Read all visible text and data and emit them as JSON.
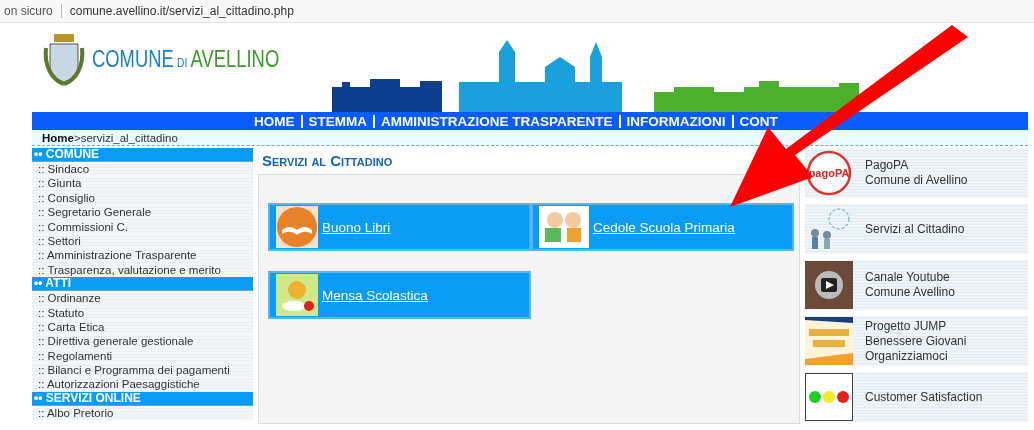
{
  "address_bar": {
    "security": "on sicuro",
    "url": "comune.avellino.it/servizi_al_cittadino.php"
  },
  "header": {
    "name_first": "COMUNE",
    "name_middle": "DI",
    "name_last": "AVELLINO"
  },
  "nav": [
    "HOME",
    "STEMMA",
    "AMMINISTRAZIONE TRASPARENTE",
    "INFORMAZIONI",
    "CONT"
  ],
  "breadcrumb": {
    "home": "Home",
    "current": ">servizi_al_cittadino"
  },
  "sidebar": [
    {
      "title": "•• COMUNE",
      "items": [
        ":: Sindaco",
        ":: Giunta",
        ":: Consiglio",
        ":: Segretario Generale",
        ":: Commissioni C.",
        ":: Settori",
        ":: Amministrazione Trasparente",
        ":: Trasparenza, valutazione e merito"
      ]
    },
    {
      "title": "•• ATTI",
      "items": [
        ":: Ordinanze",
        ":: Statuto",
        ":: Carta Etica",
        ":: Direttiva generale gestionale",
        ":: Regolamenti",
        ":: Bilanci e Programma dei pagamenti",
        ":: Autorizzazioni Paesaggistiche"
      ]
    },
    {
      "title": "•• SERVIZI ONLINE",
      "items": [
        ":: Albo Pretorio"
      ]
    }
  ],
  "main": {
    "title": "Servizi al Cittadino",
    "tiles": [
      {
        "label": "Buono Libri",
        "kind": "book"
      },
      {
        "label": "Cedole Scuola Primaria",
        "kind": "kids"
      },
      {
        "label": "Mensa Scolastica",
        "kind": "chef"
      }
    ]
  },
  "right_links": [
    {
      "kind": "pagopa",
      "logo_text": "pagoPA",
      "lines": [
        "PagoPA",
        "Comune di Avellino"
      ]
    },
    {
      "kind": "people",
      "lines": [
        "Servizi al Cittadino"
      ]
    },
    {
      "kind": "video",
      "lines": [
        "Canale Youtube",
        "Comune Avellino"
      ]
    },
    {
      "kind": "poster",
      "lines": [
        "Progetto JUMP",
        "Benessere Giovani",
        "Organizziamoci"
      ]
    },
    {
      "kind": "smileys",
      "lines": [
        "Customer Satisfaction"
      ]
    }
  ]
}
